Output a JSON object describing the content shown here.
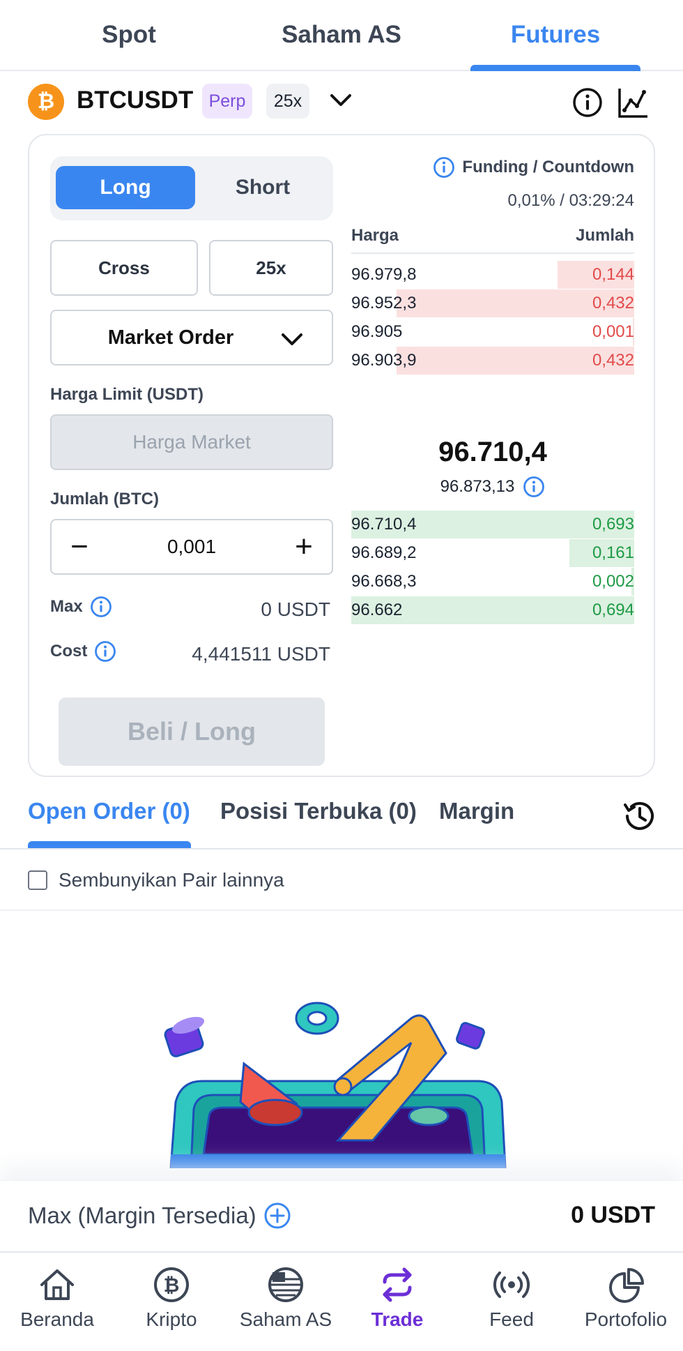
{
  "market_tabs": [
    {
      "label": "Spot",
      "active": false
    },
    {
      "label": "Saham AS",
      "active": false
    },
    {
      "label": "Futures",
      "active": true
    }
  ],
  "pair": {
    "logo_symbol": "₿",
    "name": "BTCUSDT",
    "type_chip": "Perp",
    "leverage_chip": "25x",
    "icons": [
      "chevron-down-icon",
      "info-icon",
      "chart-icon"
    ]
  },
  "trade_form": {
    "side_long": "Long",
    "side_short": "Short",
    "margin_mode": "Cross",
    "leverage": "25x",
    "order_type": "Market Order",
    "limit_price_label": "Harga Limit (USDT)",
    "limit_price_placeholder": "Harga Market",
    "qty_label": "Jumlah (BTC)",
    "qty_value": "0,001",
    "minus": "−",
    "plus": "+",
    "max_label": "Max",
    "max_value": "0 USDT",
    "cost_label": "Cost",
    "cost_value": "4,441511 USDT",
    "submit_label": "Beli / Long"
  },
  "order_book": {
    "funding_label": "Funding / Countdown",
    "funding_value": "0,01% / 03:29:24",
    "col_price": "Harga",
    "col_qty": "Jumlah",
    "asks": [
      {
        "price": "96.979,8",
        "qty": "0,144",
        "depth": 0.27
      },
      {
        "price": "96.952,3",
        "qty": "0,432",
        "depth": 0.84
      },
      {
        "price": "96.905",
        "qty": "0,001",
        "depth": 0.0
      },
      {
        "price": "96.903,9",
        "qty": "0,432",
        "depth": 0.84
      }
    ],
    "last_price": "96.710,4",
    "mark_price": "96.873,13",
    "bids": [
      {
        "price": "96.710,4",
        "qty": "0,693",
        "depth": 1.0
      },
      {
        "price": "96.689,2",
        "qty": "0,161",
        "depth": 0.23
      },
      {
        "price": "96.668,3",
        "qty": "0,002",
        "depth": 0.01
      },
      {
        "price": "96.662",
        "qty": "0,694",
        "depth": 1.0
      }
    ]
  },
  "order_tabs": [
    {
      "label": "Open Order (0)",
      "active": true
    },
    {
      "label": "Posisi Terbuka (0)",
      "active": false
    },
    {
      "label": "Margin",
      "active": false
    }
  ],
  "hide_pairs_label": "Sembunyikan Pair lainnya",
  "max_margin": {
    "label": "Max (Margin Tersedia)",
    "value": "0 USDT"
  },
  "bottom_nav": [
    {
      "label": "Beranda",
      "icon": "home-icon",
      "active": false
    },
    {
      "label": "Kripto",
      "icon": "bitcoin-icon",
      "active": false
    },
    {
      "label": "Saham AS",
      "icon": "us-flag-icon",
      "active": false
    },
    {
      "label": "Trade",
      "icon": "swap-icon",
      "active": true
    },
    {
      "label": "Feed",
      "icon": "broadcast-icon",
      "active": false
    },
    {
      "label": "Portofolio",
      "icon": "pie-chart-icon",
      "active": false
    }
  ],
  "colors": {
    "accent": "#3a86f0",
    "ask": "#e24a4a",
    "bid": "#1f9a46",
    "nav_active": "#6c2fd6",
    "btc": "#f7931a"
  }
}
